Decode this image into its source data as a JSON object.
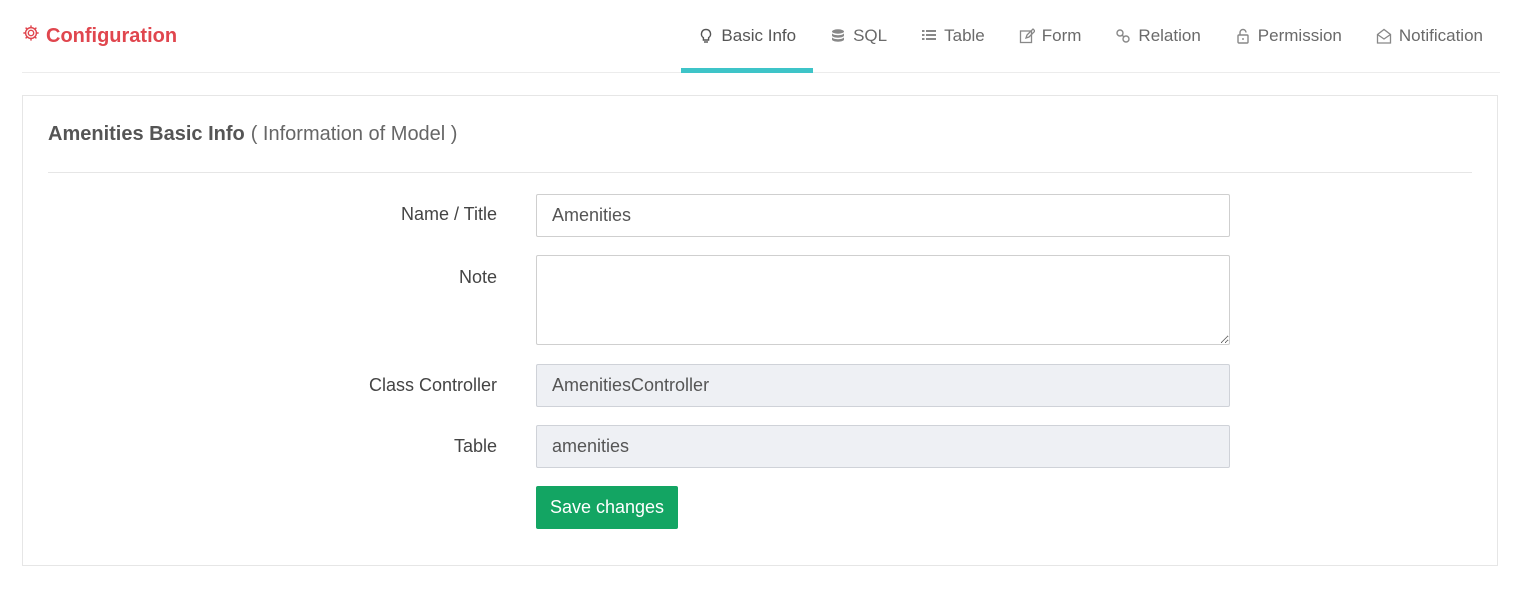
{
  "header": {
    "brand_icon": "gear-icon",
    "brand_title": "Configuration",
    "brand_color": "#e0464e",
    "accent_color": "#3ec4c8",
    "tabs": [
      {
        "label": "Basic Info",
        "icon": "lightbulb-icon",
        "active": true
      },
      {
        "label": "SQL",
        "icon": "database-icon",
        "active": false
      },
      {
        "label": "Table",
        "icon": "list-icon",
        "active": false
      },
      {
        "label": "Form",
        "icon": "edit-icon",
        "active": false
      },
      {
        "label": "Relation",
        "icon": "link-icon",
        "active": false
      },
      {
        "label": "Permission",
        "icon": "lock-icon",
        "active": false
      },
      {
        "label": "Notification",
        "icon": "envelope-open-icon",
        "active": false
      }
    ]
  },
  "panel": {
    "title": "Amenities Basic Info",
    "subtitle": "( Information of Model )",
    "fields": {
      "name": {
        "label": "Name / Title",
        "value": "Amenities"
      },
      "note": {
        "label": "Note",
        "value": ""
      },
      "controller": {
        "label": "Class Controller",
        "value": "AmenitiesController"
      },
      "table": {
        "label": "Table",
        "value": "amenities"
      }
    },
    "save_label": "Save changes",
    "save_color": "#13a563"
  }
}
